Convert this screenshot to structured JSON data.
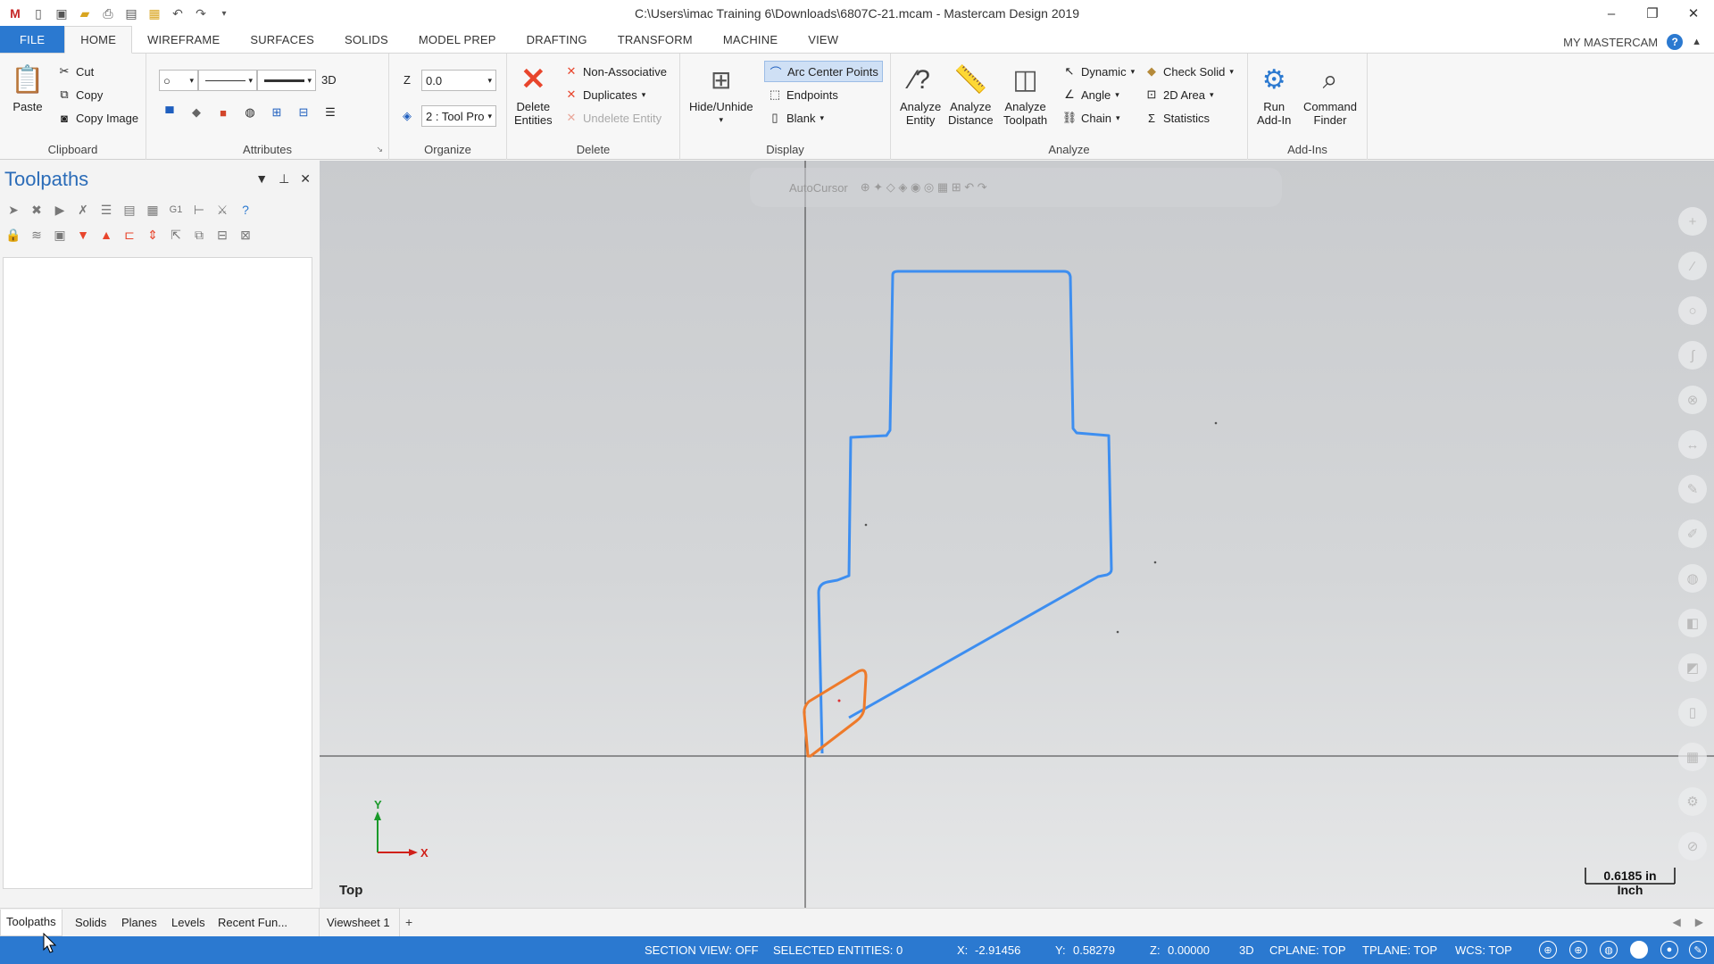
{
  "window": {
    "title": "C:\\Users\\imac Training 6\\Downloads\\6807C-21.mcam - Mastercam Design 2019"
  },
  "tabs": [
    "FILE",
    "HOME",
    "WIREFRAME",
    "SURFACES",
    "SOLIDS",
    "MODEL PREP",
    "DRAFTING",
    "TRANSFORM",
    "MACHINE",
    "VIEW"
  ],
  "account_label": "MY MASTERCAM",
  "ribbon": {
    "clipboard": {
      "paste": "Paste",
      "cut": "Cut",
      "copy": "Copy",
      "copy_image": "Copy Image",
      "label": "Clipboard"
    },
    "attributes": {
      "label": "Attributes",
      "mode_3d": "3D"
    },
    "organize": {
      "z_label": "Z",
      "z_value": "0.0",
      "level": "2 : Tool Pro",
      "label": "Organize"
    },
    "delete": {
      "delete_entities": "Delete\nEntities",
      "non_associative": "Non-Associative",
      "duplicates": "Duplicates",
      "undelete": "Undelete Entity",
      "label": "Delete"
    },
    "display": {
      "hide_unhide": "Hide/Unhide",
      "arc_center": "Arc Center Points",
      "endpoints": "Endpoints",
      "blank": "Blank",
      "label": "Display"
    },
    "analyze": {
      "entity": "Analyze\nEntity",
      "distance": "Analyze\nDistance",
      "toolpath": "Analyze\nToolpath",
      "dynamic": "Dynamic",
      "angle": "Angle",
      "chain": "Chain",
      "check_solid": "Check Solid",
      "area_2d": "2D Area",
      "statistics": "Statistics",
      "label": "Analyze"
    },
    "addins": {
      "run_addin": "Run\nAdd-In",
      "command_finder": "Command\nFinder",
      "label": "Add-Ins"
    }
  },
  "panel": {
    "title": "Toolpaths"
  },
  "viewport": {
    "autocursor_label": "AutoCursor",
    "view_name": "Top",
    "axis_x": "X",
    "axis_y": "Y",
    "scale_value": "0.6185 in",
    "scale_unit": "Inch",
    "colors": {
      "part": "#3d8ef0",
      "tool": "#ee7a2a",
      "axis": "#444444"
    }
  },
  "bottom_tabs": [
    "Toolpaths",
    "Solids",
    "Planes",
    "Levels",
    "Recent Fun..."
  ],
  "viewsheet": "Viewsheet 1",
  "status": {
    "section_view": "SECTION VIEW: OFF",
    "selected": "SELECTED ENTITIES: 0",
    "x_label": "X:",
    "x_value": "-2.91456",
    "y_label": "Y:",
    "y_value": "0.58279",
    "z_label": "Z:",
    "z_value": "0.00000",
    "mode": "3D",
    "cplane": "CPLANE: TOP",
    "tplane": "TPLANE: TOP",
    "wcs": "WCS: TOP"
  }
}
